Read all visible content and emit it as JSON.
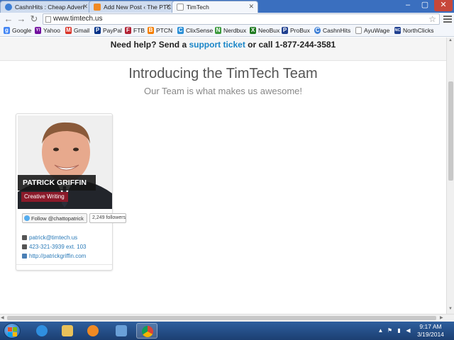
{
  "browser": {
    "tabs": [
      {
        "label": "CashnHits : Cheap Advert",
        "favicon_color": "#3d7fd6"
      },
      {
        "label": "Add New Post ‹ The PTC R",
        "favicon_color": "#f08a24"
      },
      {
        "label": "TimTech",
        "favicon_color": "#ffffff"
      }
    ],
    "url": "www.timtech.us",
    "bookmarks": [
      {
        "label": "Google",
        "icon": "google-icon",
        "color": "#4285f4",
        "glyph": "g"
      },
      {
        "label": "Yahoo",
        "icon": "yahoo-icon",
        "color": "#720e9e",
        "glyph": "Y!"
      },
      {
        "label": "Gmail",
        "icon": "gmail-icon",
        "color": "#d93025",
        "glyph": "M"
      },
      {
        "label": "PayPal",
        "icon": "paypal-icon",
        "color": "#003087",
        "glyph": "P"
      },
      {
        "label": "FTB",
        "icon": "flag-icon",
        "color": "#b22234",
        "glyph": "F"
      },
      {
        "label": "PTCN",
        "icon": "blogger-icon",
        "color": "#f57d00",
        "glyph": "B"
      },
      {
        "label": "ClixSense",
        "icon": "clixsense-icon",
        "color": "#2a8fd6",
        "glyph": "C"
      },
      {
        "label": "Nerdbux",
        "icon": "nerdbux-icon",
        "color": "#3c9a3c",
        "glyph": "N"
      },
      {
        "label": "NeoBux",
        "icon": "neobux-icon",
        "color": "#1f7a1f",
        "glyph": "X"
      },
      {
        "label": "ProBux",
        "icon": "probux-icon",
        "color": "#1f3f8f",
        "glyph": "P"
      },
      {
        "label": "CashnHits",
        "icon": "cashnhits-icon",
        "color": "#3d7fd6",
        "glyph": "C"
      },
      {
        "label": "AyuWage",
        "icon": "page-icon",
        "color": "#999999",
        "glyph": ""
      },
      {
        "label": "NorthClicks",
        "icon": "northclicks-icon",
        "color": "#1f3f8f",
        "glyph": "NC"
      }
    ]
  },
  "page": {
    "help_prefix": "Need help? Send a ",
    "help_link": "support ticket",
    "help_suffix": " or call 1-877-244-3581",
    "title": "Introducing the TimTech Team",
    "subtitle": "Our Team is what makes us awesome!",
    "member": {
      "name": "PATRICK GRIFFIN",
      "role": "Creative Writing",
      "follow_label": "Follow @chattopatrick",
      "followers": "2,249 followers",
      "contacts": [
        {
          "icon": "email-icon",
          "text": "patrick@timtech.us"
        },
        {
          "icon": "phone-icon",
          "text": "423-321-3939 ext. 103"
        },
        {
          "icon": "link-icon",
          "text": "http://patrickgriffin.com"
        }
      ]
    }
  },
  "taskbar": {
    "apps": [
      {
        "icon": "internet-explorer-icon",
        "color": "#2f8fe0",
        "open": false
      },
      {
        "icon": "file-explorer-icon",
        "color": "#e8c15a",
        "open": false
      },
      {
        "icon": "media-player-icon",
        "color": "#f08a24",
        "open": false
      },
      {
        "icon": "network-app-icon",
        "color": "#6aa0d8",
        "open": false
      },
      {
        "icon": "chrome-icon",
        "color": "#db4437",
        "open": true
      }
    ],
    "time": "9:17 AM",
    "date": "3/19/2014"
  }
}
